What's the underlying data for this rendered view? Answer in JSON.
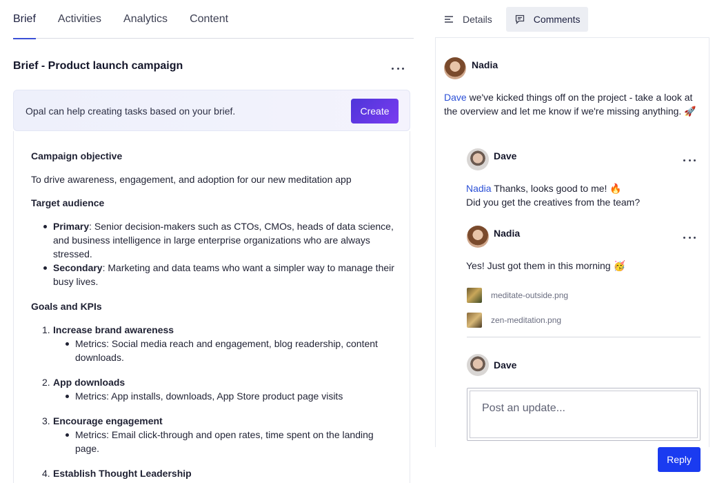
{
  "tabs": [
    {
      "label": "Brief"
    },
    {
      "label": "Activities"
    },
    {
      "label": "Analytics"
    },
    {
      "label": "Content"
    }
  ],
  "brief": {
    "title": "Brief - Product launch campaign",
    "banner_text": "Opal can help creating tasks based on your brief.",
    "create_label": "Create",
    "objective_heading": "Campaign objective",
    "objective_text": "To drive awareness, engagement, and adoption for our new meditation app",
    "audience_heading": "Target audience",
    "audience": [
      {
        "label": "Primary",
        "text": ": Senior decision-makers such as CTOs, CMOs, heads of data science, and business intelligence in large enterprise organizations who are always stressed."
      },
      {
        "label": "Secondary",
        "text": ": Marketing and data teams who want a simpler way to manage their busy lives."
      }
    ],
    "goals_heading": "Goals and KPIs",
    "goals": [
      {
        "num": "1.",
        "title": "Increase brand awareness",
        "metric": "Metrics: Social media reach and engagement, blog readership, content downloads."
      },
      {
        "num": "2.",
        "title": "App downloads",
        "metric": "Metrics: App installs, downloads, App Store product page visits"
      },
      {
        "num": "3.",
        "title": "Encourage engagement",
        "metric": "Metrics: Email click-through and open rates, time spent on the landing page."
      },
      {
        "num": "4.",
        "title": "Establish Thought Leadership",
        "metric": ""
      }
    ]
  },
  "right_tabs": {
    "details_label": "Details",
    "comments_label": "Comments"
  },
  "comments": {
    "c1": {
      "author": "Nadia",
      "mention": "Dave",
      "text": " we've kicked things off on the project - take a look at the overview and let me know if we're missing anything. 🚀"
    },
    "c2": {
      "author": "Dave",
      "mention": "Nadia",
      "text_line1": " Thanks, looks good to me! 🔥",
      "text_line2": "Did you get the creatives from the team?"
    },
    "c3": {
      "author": "Nadia",
      "text": "Yes! Just got them in this morning 🥳"
    },
    "attachments": [
      {
        "name": "meditate-outside.png"
      },
      {
        "name": "zen-meditation.png"
      }
    ],
    "composer": {
      "author": "Dave",
      "placeholder": "Post an update...",
      "reply_label": "Reply"
    }
  }
}
